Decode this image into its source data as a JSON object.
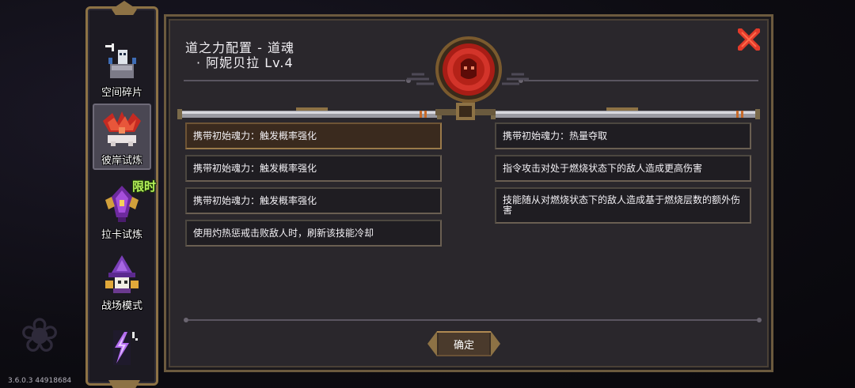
{
  "version": "3.6.0.3 44918684",
  "sidebar": {
    "items": [
      {
        "label": "空间碎片",
        "icon": "space-fragment-icon"
      },
      {
        "label": "彼岸试炼",
        "icon": "red-dragon-icon",
        "active": true
      },
      {
        "label": "拉卡试炼",
        "icon": "purple-crystal-icon",
        "badge": "限时"
      },
      {
        "label": "战场模式",
        "icon": "wizard-hat-icon"
      },
      {
        "label": "",
        "icon": "lightning-icon"
      }
    ]
  },
  "panel": {
    "title_line1": "道之力配置 - 道魂",
    "title_line2": "· 阿妮贝拉 Lv.4",
    "emblem_icon": "red-soul-emblem-icon",
    "close_icon": "close-x-icon",
    "left_entries": [
      "携带初始魂力：触发概率强化",
      "携带初始魂力：触发概率强化",
      "携带初始魂力：触发概率强化",
      "使用灼热惩戒击败敌人时，刷新该技能冷却"
    ],
    "right_entries": [
      "携带初始魂力：热量夺取",
      "指令攻击对处于燃烧状态下的敌人造成更高伤害",
      "技能随从对燃烧状态下的敌人造成基于燃烧层数的额外伤害"
    ],
    "confirm_label": "确定"
  },
  "colors": {
    "panel_bg": "#2a272c",
    "frame_gold": "#8d7245",
    "close_red": "#e23a2a",
    "emblem_red": "#c4261c",
    "limited_green": "#b6f25a"
  }
}
